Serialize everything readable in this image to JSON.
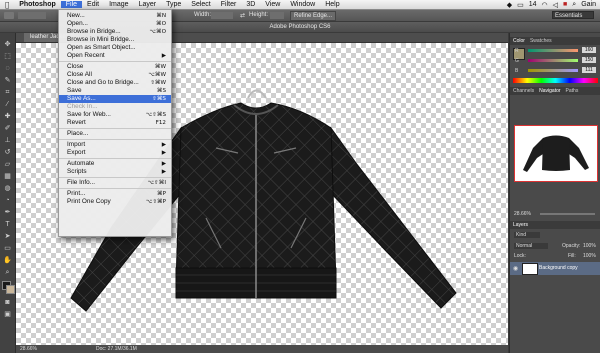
{
  "menubar": {
    "apple": "",
    "items": [
      {
        "label": "Photoshop",
        "bold": true
      },
      {
        "label": "File",
        "active": true
      },
      {
        "label": "Edit"
      },
      {
        "label": "Image"
      },
      {
        "label": "Layer"
      },
      {
        "label": "Type"
      },
      {
        "label": "Select"
      },
      {
        "label": "Filter"
      },
      {
        "label": "3D"
      },
      {
        "label": "View"
      },
      {
        "label": "Window"
      },
      {
        "label": "Help"
      }
    ],
    "status_battery": "14",
    "user": "Gain"
  },
  "options_bar": {
    "width_label": "Width:",
    "height_label": "Height:",
    "refine_label": "Refine Edge...",
    "workspace": "Essentials"
  },
  "window_title": "Adobe Photoshop CS6",
  "document_tab": "leather Jacket...",
  "status_bar": {
    "zoom": "28.66%",
    "doc": "Doc: 27.1M/36.1M"
  },
  "panels": {
    "color_tabs": [
      "Color",
      "Swatches"
    ],
    "color_values": {
      "r": "160",
      "g": "150",
      "b": "111"
    },
    "color_labels": {
      "r": "R",
      "g": "G",
      "b": "B"
    },
    "nav_tabs": [
      "Channels",
      "Navigator",
      "Paths"
    ],
    "nav_zoom": "28.66%",
    "layers_tab": "Layers",
    "layers_kind": "Kind",
    "blend_mode": "Normal",
    "opacity_label": "Opacity:",
    "opacity_value": "100%",
    "lock_label": "Lock:",
    "fill_label": "Fill:",
    "fill_value": "100%",
    "layer_name": "Background copy"
  },
  "file_menu": [
    {
      "label": "New...",
      "shortcut": "⌘N"
    },
    {
      "label": "Open...",
      "shortcut": "⌘O"
    },
    {
      "label": "Browse in Bridge...",
      "shortcut": "⌥⌘O"
    },
    {
      "label": "Browse in Mini Bridge...",
      "shortcut": ""
    },
    {
      "label": "Open as Smart Object...",
      "shortcut": ""
    },
    {
      "label": "Open Recent",
      "shortcut": "▶"
    },
    {
      "sep": true
    },
    {
      "label": "Close",
      "shortcut": "⌘W"
    },
    {
      "label": "Close All",
      "shortcut": "⌥⌘W"
    },
    {
      "label": "Close and Go to Bridge...",
      "shortcut": "⇧⌘W"
    },
    {
      "label": "Save",
      "shortcut": "⌘S"
    },
    {
      "label": "Save As...",
      "shortcut": "⇧⌘S",
      "highlight": true
    },
    {
      "label": "Check In...",
      "shortcut": "",
      "disabled": true
    },
    {
      "label": "Save for Web...",
      "shortcut": "⌥⇧⌘S"
    },
    {
      "label": "Revert",
      "shortcut": "F12"
    },
    {
      "sep": true
    },
    {
      "label": "Place...",
      "shortcut": ""
    },
    {
      "sep": true
    },
    {
      "label": "Import",
      "shortcut": "▶"
    },
    {
      "label": "Export",
      "shortcut": "▶"
    },
    {
      "sep": true
    },
    {
      "label": "Automate",
      "shortcut": "▶"
    },
    {
      "label": "Scripts",
      "shortcut": "▶"
    },
    {
      "sep": true
    },
    {
      "label": "File Info...",
      "shortcut": "⌥⇧⌘I"
    },
    {
      "sep": true
    },
    {
      "label": "Print...",
      "shortcut": "⌘P"
    },
    {
      "label": "Print One Copy",
      "shortcut": "⌥⇧⌘P"
    }
  ],
  "colors": {
    "highlight": "#3d6fd8",
    "jacket": "#1c1c1c"
  }
}
